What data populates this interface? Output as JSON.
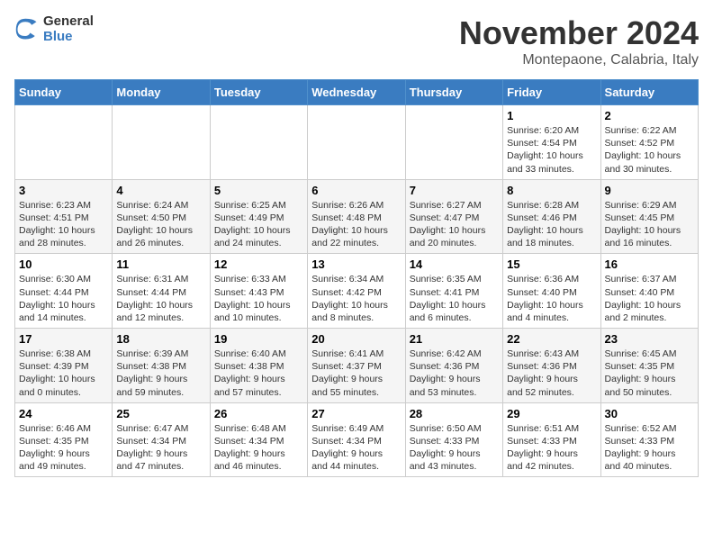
{
  "logo": {
    "line1": "General",
    "line2": "Blue"
  },
  "header": {
    "title": "November 2024",
    "location": "Montepaone, Calabria, Italy"
  },
  "days_of_week": [
    "Sunday",
    "Monday",
    "Tuesday",
    "Wednesday",
    "Thursday",
    "Friday",
    "Saturday"
  ],
  "weeks": [
    [
      {
        "num": "",
        "info": ""
      },
      {
        "num": "",
        "info": ""
      },
      {
        "num": "",
        "info": ""
      },
      {
        "num": "",
        "info": ""
      },
      {
        "num": "",
        "info": ""
      },
      {
        "num": "1",
        "info": "Sunrise: 6:20 AM\nSunset: 4:54 PM\nDaylight: 10 hours\nand 33 minutes."
      },
      {
        "num": "2",
        "info": "Sunrise: 6:22 AM\nSunset: 4:52 PM\nDaylight: 10 hours\nand 30 minutes."
      }
    ],
    [
      {
        "num": "3",
        "info": "Sunrise: 6:23 AM\nSunset: 4:51 PM\nDaylight: 10 hours\nand 28 minutes."
      },
      {
        "num": "4",
        "info": "Sunrise: 6:24 AM\nSunset: 4:50 PM\nDaylight: 10 hours\nand 26 minutes."
      },
      {
        "num": "5",
        "info": "Sunrise: 6:25 AM\nSunset: 4:49 PM\nDaylight: 10 hours\nand 24 minutes."
      },
      {
        "num": "6",
        "info": "Sunrise: 6:26 AM\nSunset: 4:48 PM\nDaylight: 10 hours\nand 22 minutes."
      },
      {
        "num": "7",
        "info": "Sunrise: 6:27 AM\nSunset: 4:47 PM\nDaylight: 10 hours\nand 20 minutes."
      },
      {
        "num": "8",
        "info": "Sunrise: 6:28 AM\nSunset: 4:46 PM\nDaylight: 10 hours\nand 18 minutes."
      },
      {
        "num": "9",
        "info": "Sunrise: 6:29 AM\nSunset: 4:45 PM\nDaylight: 10 hours\nand 16 minutes."
      }
    ],
    [
      {
        "num": "10",
        "info": "Sunrise: 6:30 AM\nSunset: 4:44 PM\nDaylight: 10 hours\nand 14 minutes."
      },
      {
        "num": "11",
        "info": "Sunrise: 6:31 AM\nSunset: 4:44 PM\nDaylight: 10 hours\nand 12 minutes."
      },
      {
        "num": "12",
        "info": "Sunrise: 6:33 AM\nSunset: 4:43 PM\nDaylight: 10 hours\nand 10 minutes."
      },
      {
        "num": "13",
        "info": "Sunrise: 6:34 AM\nSunset: 4:42 PM\nDaylight: 10 hours\nand 8 minutes."
      },
      {
        "num": "14",
        "info": "Sunrise: 6:35 AM\nSunset: 4:41 PM\nDaylight: 10 hours\nand 6 minutes."
      },
      {
        "num": "15",
        "info": "Sunrise: 6:36 AM\nSunset: 4:40 PM\nDaylight: 10 hours\nand 4 minutes."
      },
      {
        "num": "16",
        "info": "Sunrise: 6:37 AM\nSunset: 4:40 PM\nDaylight: 10 hours\nand 2 minutes."
      }
    ],
    [
      {
        "num": "17",
        "info": "Sunrise: 6:38 AM\nSunset: 4:39 PM\nDaylight: 10 hours\nand 0 minutes."
      },
      {
        "num": "18",
        "info": "Sunrise: 6:39 AM\nSunset: 4:38 PM\nDaylight: 9 hours\nand 59 minutes."
      },
      {
        "num": "19",
        "info": "Sunrise: 6:40 AM\nSunset: 4:38 PM\nDaylight: 9 hours\nand 57 minutes."
      },
      {
        "num": "20",
        "info": "Sunrise: 6:41 AM\nSunset: 4:37 PM\nDaylight: 9 hours\nand 55 minutes."
      },
      {
        "num": "21",
        "info": "Sunrise: 6:42 AM\nSunset: 4:36 PM\nDaylight: 9 hours\nand 53 minutes."
      },
      {
        "num": "22",
        "info": "Sunrise: 6:43 AM\nSunset: 4:36 PM\nDaylight: 9 hours\nand 52 minutes."
      },
      {
        "num": "23",
        "info": "Sunrise: 6:45 AM\nSunset: 4:35 PM\nDaylight: 9 hours\nand 50 minutes."
      }
    ],
    [
      {
        "num": "24",
        "info": "Sunrise: 6:46 AM\nSunset: 4:35 PM\nDaylight: 9 hours\nand 49 minutes."
      },
      {
        "num": "25",
        "info": "Sunrise: 6:47 AM\nSunset: 4:34 PM\nDaylight: 9 hours\nand 47 minutes."
      },
      {
        "num": "26",
        "info": "Sunrise: 6:48 AM\nSunset: 4:34 PM\nDaylight: 9 hours\nand 46 minutes."
      },
      {
        "num": "27",
        "info": "Sunrise: 6:49 AM\nSunset: 4:34 PM\nDaylight: 9 hours\nand 44 minutes."
      },
      {
        "num": "28",
        "info": "Sunrise: 6:50 AM\nSunset: 4:33 PM\nDaylight: 9 hours\nand 43 minutes."
      },
      {
        "num": "29",
        "info": "Sunrise: 6:51 AM\nSunset: 4:33 PM\nDaylight: 9 hours\nand 42 minutes."
      },
      {
        "num": "30",
        "info": "Sunrise: 6:52 AM\nSunset: 4:33 PM\nDaylight: 9 hours\nand 40 minutes."
      }
    ]
  ]
}
